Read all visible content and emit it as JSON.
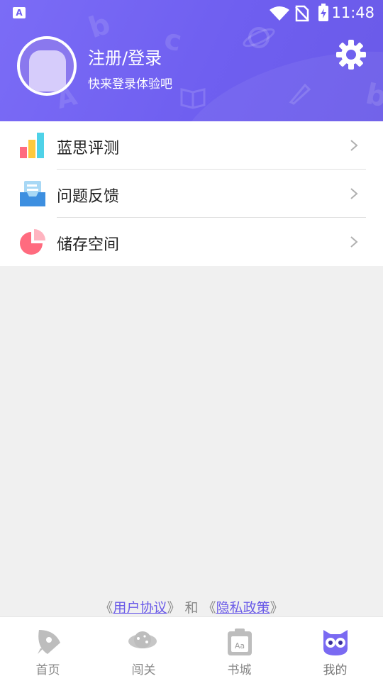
{
  "status_bar": {
    "time": "11:48"
  },
  "profile": {
    "title": "注册/登录",
    "subtitle": "快来登录体验吧",
    "settings_icon": "gear-icon"
  },
  "menu": {
    "items": [
      {
        "label": "蓝思评测",
        "icon": "bar-chart-icon"
      },
      {
        "label": "问题反馈",
        "icon": "feedback-inbox-icon"
      },
      {
        "label": "储存空间",
        "icon": "pie-chart-icon"
      }
    ]
  },
  "agreement": {
    "open1": "《",
    "link1": "用户协议",
    "close1": "》",
    "and": " 和 ",
    "open2": "《",
    "link2": "隐私政策",
    "close2": "》"
  },
  "tabs": [
    {
      "label": "首页",
      "icon": "rocket-icon"
    },
    {
      "label": "闯关",
      "icon": "planet-icon"
    },
    {
      "label": "书城",
      "icon": "book-icon"
    },
    {
      "label": "我的",
      "icon": "owl-icon",
      "active": true
    }
  ],
  "colors": {
    "brand": "#6f5ff0",
    "link": "#6a5ae8"
  }
}
